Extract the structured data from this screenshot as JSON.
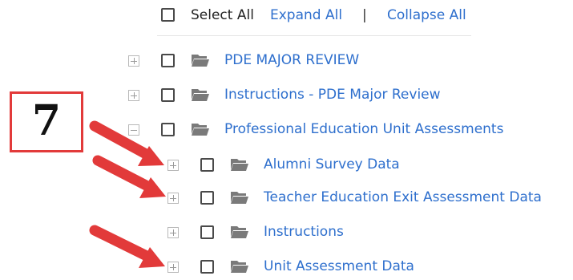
{
  "toolbar": {
    "select_all_label": "Select All",
    "expand_all_label": "Expand All",
    "separator": "|",
    "collapse_all_label": "Collapse All"
  },
  "tree": [
    {
      "label": "PDE MAJOR REVIEW",
      "level": 0,
      "state": "collapsed"
    },
    {
      "label": "Instructions - PDE Major Review",
      "level": 0,
      "state": "collapsed"
    },
    {
      "label": "Professional Education Unit Assessments",
      "level": 0,
      "state": "expanded"
    },
    {
      "label": "Alumni Survey Data",
      "level": 1,
      "state": "collapsed"
    },
    {
      "label": "Teacher Education Exit Assessment Data",
      "level": 1,
      "state": "collapsed"
    },
    {
      "label": "Instructions",
      "level": 1,
      "state": "collapsed"
    },
    {
      "label": "Unit Assessment Data",
      "level": 1,
      "state": "collapsed"
    }
  ],
  "annotation": {
    "step_number": "7",
    "color": "#e23a3a"
  },
  "colors": {
    "link": "#2e6fcd",
    "folder": "#7a7a7a",
    "checkbox_border": "#4a4a4a"
  }
}
